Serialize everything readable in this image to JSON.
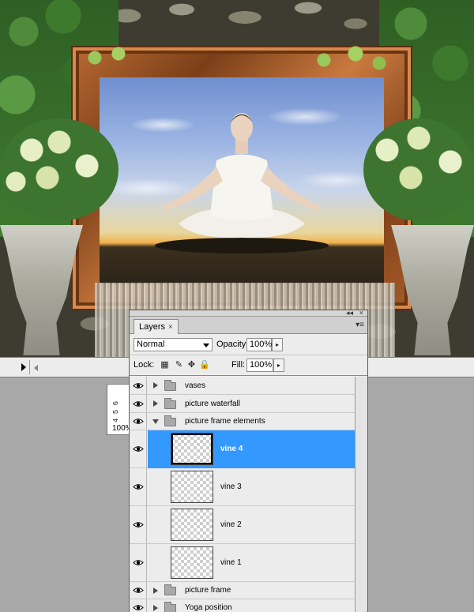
{
  "artwork": {
    "subject": "yoga-pose-photo-in-ornate-frame",
    "colors": {
      "sky_top": "#6f8fcf",
      "sunset": "#f0b24d",
      "frame": "#b96a34",
      "ivy": "#3f7a30"
    }
  },
  "navigator": {
    "ruler_text": "4 5 6",
    "zoom": "100%"
  },
  "layers_panel": {
    "tab_label": "Layers",
    "tab_close": "×",
    "blend_mode": "Normal",
    "opacity_label": "Opacity:",
    "opacity_value": "100%",
    "lock_label": "Lock:",
    "fill_label": "Fill:",
    "fill_value": "100%",
    "selection_color": "#3399ff",
    "layers": [
      {
        "name": "vases",
        "type": "group",
        "expanded": false,
        "visible": true
      },
      {
        "name": "picture waterfall",
        "type": "group",
        "expanded": false,
        "visible": true
      },
      {
        "name": "picture frame elements",
        "type": "group",
        "expanded": true,
        "visible": true
      },
      {
        "name": "vine 4",
        "type": "layer",
        "selected": true,
        "visible": true
      },
      {
        "name": "vine 3",
        "type": "layer",
        "selected": false,
        "visible": true
      },
      {
        "name": "vine 2",
        "type": "layer",
        "selected": false,
        "visible": true
      },
      {
        "name": "vine 1",
        "type": "layer",
        "selected": false,
        "visible": true
      },
      {
        "name": "picture frame",
        "type": "group",
        "expanded": false,
        "visible": true
      },
      {
        "name": "Yoga position",
        "type": "group",
        "expanded": false,
        "visible": true
      }
    ]
  }
}
